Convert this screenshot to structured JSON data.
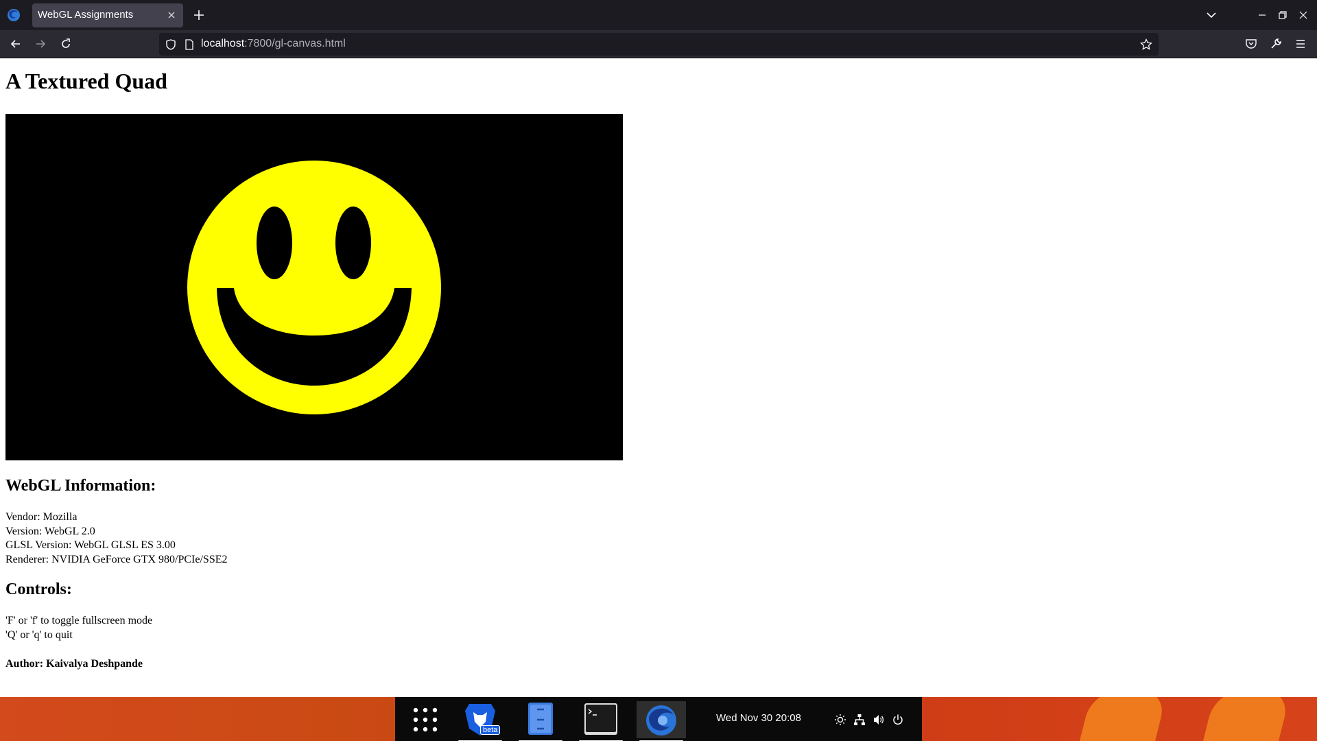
{
  "browser": {
    "tab_title": "WebGL Assignments",
    "url_host": "localhost",
    "url_path": ":7800/gl-canvas.html"
  },
  "page": {
    "title": "A Textured Quad",
    "webgl_heading": "WebGL Information:",
    "vendor": "Vendor: Mozilla",
    "version": "Version: WebGL 2.0",
    "glsl_version": "GLSL Version: WebGL GLSL ES 3.00",
    "renderer": "Renderer: NVIDIA GeForce GTX 980/PCIe/SSE2",
    "controls_heading": "Controls:",
    "controls": [
      "'F' or 'f' to toggle fullscreen mode",
      "'Q' or 'q' to quit"
    ],
    "author": "Author: Kaivalya Deshpande"
  },
  "canvas": {
    "background": "#000000",
    "face_color": "#ffff00",
    "feature_color": "#000000"
  },
  "taskbar": {
    "apps": [
      "app-grid",
      "brave-beta",
      "files",
      "terminal",
      "firefox"
    ],
    "brave_badge": "beta",
    "datetime": "Wed Nov 30  20:08",
    "accent": "#cb4a14"
  }
}
